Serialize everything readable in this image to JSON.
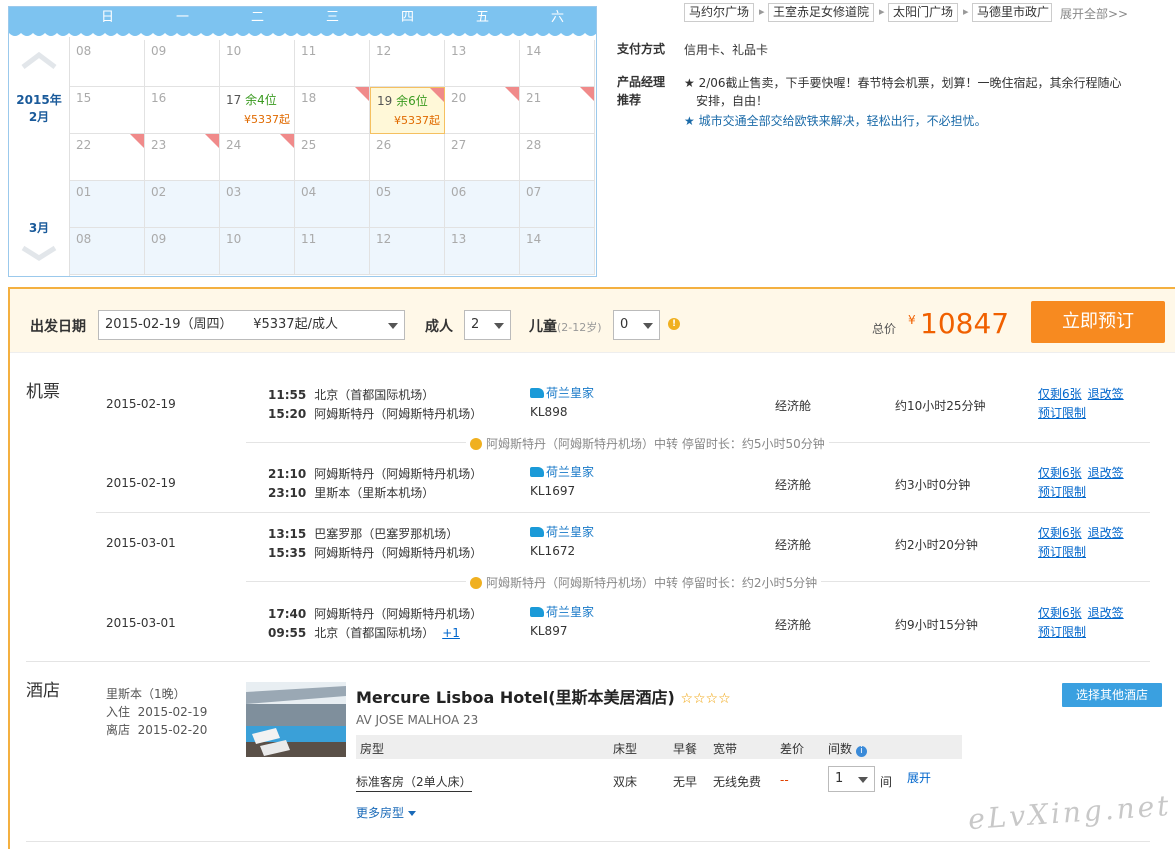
{
  "calendar": {
    "weekdays": [
      "日",
      "一",
      "二",
      "三",
      "四",
      "五",
      "六"
    ],
    "feb_label": "2015年\n2月",
    "mar_label": "3月",
    "rows": [
      [
        {
          "d": "08"
        },
        {
          "d": "09"
        },
        {
          "d": "10"
        },
        {
          "d": "11"
        },
        {
          "d": "12"
        },
        {
          "d": "13"
        },
        {
          "d": "14"
        }
      ],
      [
        {
          "d": "15"
        },
        {
          "d": "16"
        },
        {
          "d": "17",
          "rem": "余4位",
          "price": "¥5337起"
        },
        {
          "d": "18",
          "tri": true
        },
        {
          "d": "19",
          "rem": "余6位",
          "price": "¥5337起",
          "sel": true,
          "tri": true
        },
        {
          "d": "20",
          "tri": true
        },
        {
          "d": "21",
          "tri": true
        }
      ],
      [
        {
          "d": "22",
          "tri": true
        },
        {
          "d": "23",
          "tri": true
        },
        {
          "d": "24",
          "tri": true
        },
        {
          "d": "25"
        },
        {
          "d": "26"
        },
        {
          "d": "27"
        },
        {
          "d": "28"
        }
      ],
      [
        {
          "d": "01"
        },
        {
          "d": "02"
        },
        {
          "d": "03"
        },
        {
          "d": "04"
        },
        {
          "d": "05"
        },
        {
          "d": "06"
        },
        {
          "d": "07"
        }
      ],
      [
        {
          "d": "08"
        },
        {
          "d": "09"
        },
        {
          "d": "10"
        },
        {
          "d": "11"
        },
        {
          "d": "12"
        },
        {
          "d": "13"
        },
        {
          "d": "14"
        }
      ]
    ]
  },
  "tags": {
    "items": [
      "马约尔广场",
      "王室赤足女修道院",
      "太阳门广场",
      "马德里市政广"
    ],
    "expand": "展开全部>>"
  },
  "payment": {
    "label": "支付方式",
    "value": "信用卡、礼品卡"
  },
  "recommend": {
    "label1": "产品经理",
    "label2": "推荐",
    "item1a": "★ 2/06截止售卖，下手要快喔！春节特会机票，划算！一晚住宿起，其余行程随心",
    "item1b": "安排，自由！",
    "item2": "★ 城市交通全部交给欧铁来解决，轻松出行，不必担忧。"
  },
  "booking": {
    "depart_label": "出发日期",
    "depart_value": "2015-02-19（周四）     ¥5337起/成人",
    "adult_label": "成人",
    "adult_value": "2",
    "child_label": "儿童",
    "child_age": "(2-12岁)",
    "child_value": "0",
    "total_label": "总价",
    "currency": "¥",
    "total": "10847",
    "order_button": "立即预订"
  },
  "flights": {
    "title": "机票",
    "list": [
      {
        "date": "2015-02-19",
        "t1": "11:55",
        "p1": "北京（首都国际机场）",
        "t2": "15:20",
        "p2": "阿姆斯特丹（阿姆斯特丹机场）",
        "airline": "荷兰皇家",
        "no": "KL898",
        "cls": "经济舱",
        "dur": "约10小时25分钟",
        "l1": "仅剩6张",
        "l2": "退改签",
        "l3": "预订限制"
      },
      {
        "date": "2015-02-19",
        "t1": "21:10",
        "p1": "阿姆斯特丹（阿姆斯特丹机场）",
        "t2": "23:10",
        "p2": "里斯本（里斯本机场）",
        "airline": "荷兰皇家",
        "no": "KL1697",
        "cls": "经济舱",
        "dur": "约3小时0分钟",
        "l1": "仅剩6张",
        "l2": "退改签",
        "l3": "预订限制"
      },
      {
        "date": "2015-03-01",
        "t1": "13:15",
        "p1": "巴塞罗那（巴塞罗那机场）",
        "t2": "15:35",
        "p2": "阿姆斯特丹（阿姆斯特丹机场）",
        "airline": "荷兰皇家",
        "no": "KL1672",
        "cls": "经济舱",
        "dur": "约2小时20分钟",
        "l1": "仅剩6张",
        "l2": "退改签",
        "l3": "预订限制"
      },
      {
        "date": "2015-03-01",
        "t1": "17:40",
        "p1": "阿姆斯特丹（阿姆斯特丹机场）",
        "t2": "09:55",
        "p2": "北京（首都国际机场）",
        "plus": "+1",
        "airline": "荷兰皇家",
        "no": "KL897",
        "cls": "经济舱",
        "dur": "约9小时15分钟",
        "l1": "仅剩6张",
        "l2": "退改签",
        "l3": "预订限制"
      }
    ],
    "transfer1": "阿姆斯特丹（阿姆斯特丹机场）中转  停留时长：约5小时50分钟",
    "transfer2": "阿姆斯特丹（阿姆斯特丹机场）中转  停留时长：约2小时5分钟"
  },
  "hotel": {
    "title": "酒店",
    "city": "里斯本（1晚）",
    "checkin_label": "入住",
    "checkin": "2015-02-19",
    "checkout_label": "离店",
    "checkout": "2015-02-20",
    "name": "Mercure Lisboa Hotel(里斯本美居酒店)",
    "stars": "☆☆☆☆",
    "address": "AV JOSE MALHOA 23",
    "other_button": "选择其他酒店",
    "headers": [
      "房型",
      "床型",
      "早餐",
      "宽带",
      "差价",
      "间数"
    ],
    "room": {
      "type": "标准客房（2单人床）",
      "bed": "双床",
      "breakfast": "无早",
      "net": "无线免费",
      "diff": "--",
      "qty": "1",
      "unit": "间",
      "expand": "展开"
    },
    "more": "更多房型"
  },
  "watermark": "eLvXing.net"
}
